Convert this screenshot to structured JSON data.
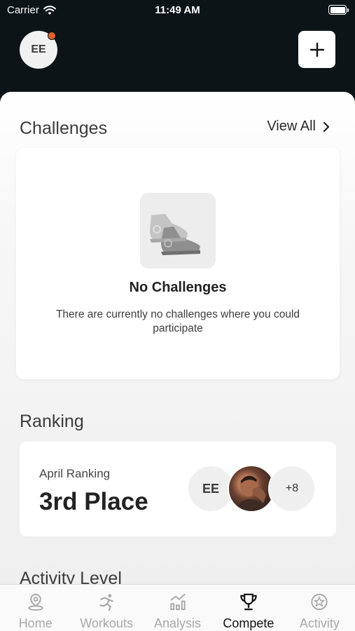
{
  "status_bar": {
    "carrier": "Carrier",
    "time": "11:49 AM"
  },
  "header": {
    "avatar_initials": "EE",
    "add_icon": "plus-icon"
  },
  "challenges": {
    "title": "Challenges",
    "view_all_label": "View All",
    "empty_title": "No Challenges",
    "empty_description": "There are currently no challenges where you could participate"
  },
  "ranking": {
    "title": "Ranking",
    "month_label": "April Ranking",
    "place": "3rd Place",
    "avatar_initials": "EE",
    "more_count": "+8"
  },
  "activity_level": {
    "title": "Activity Level"
  },
  "tabs": [
    {
      "label": "Home",
      "icon": "location-pin-icon",
      "active": false
    },
    {
      "label": "Workouts",
      "icon": "runner-icon",
      "active": false
    },
    {
      "label": "Analysis",
      "icon": "bar-chart-icon",
      "active": false
    },
    {
      "label": "Compete",
      "icon": "trophy-icon",
      "active": true
    },
    {
      "label": "Activity",
      "icon": "star-badge-icon",
      "active": false
    }
  ],
  "colors": {
    "header_bg": "#0c1418",
    "notification_dot": "#e0622f",
    "inactive_tab": "#a8a8a8"
  }
}
